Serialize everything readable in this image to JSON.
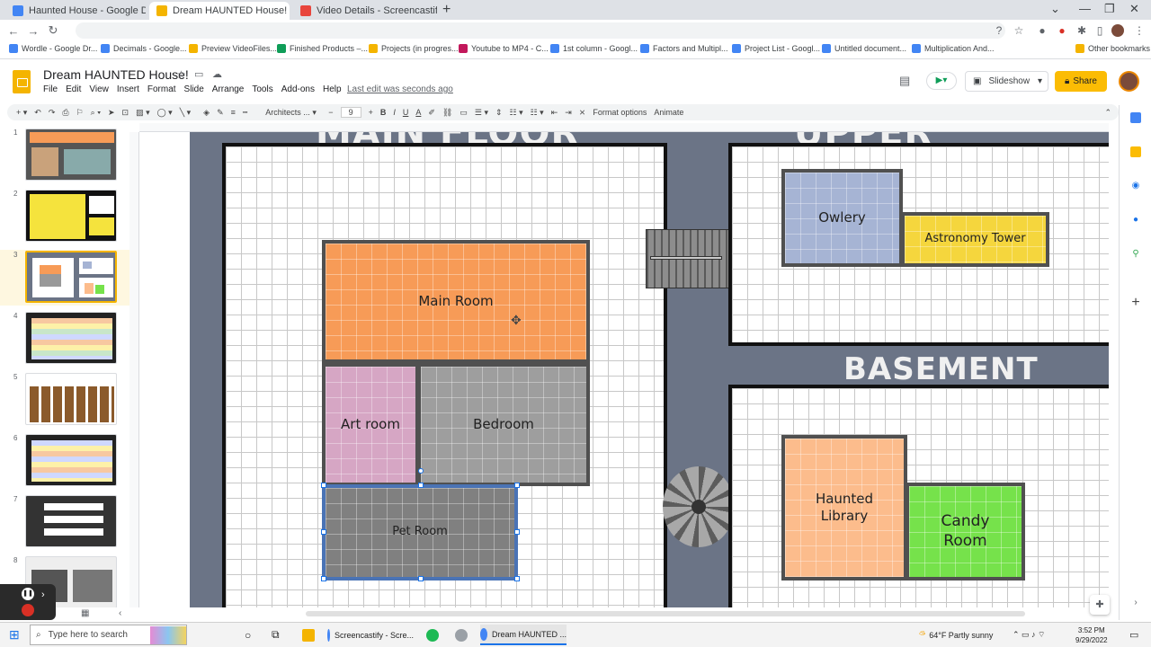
{
  "browser": {
    "tabs": [
      {
        "label": "Haunted House - Google Drive",
        "color": "#4285f4",
        "active": false
      },
      {
        "label": "Dream HAUNTED House! - Goog",
        "color": "#f4b400",
        "active": true
      },
      {
        "label": "Video Details - Screencastify",
        "color": "#e8453c",
        "active": false
      }
    ],
    "bookmarks": [
      {
        "label": "Wordle - Google Dr...",
        "color": "#4285f4"
      },
      {
        "label": "Decimals - Google...",
        "color": "#4285f4"
      },
      {
        "label": "Preview VideoFiles...",
        "color": "#f4b400"
      },
      {
        "label": "Finished Products –...",
        "color": "#0f9d58"
      },
      {
        "label": "Projects (in progres...",
        "color": "#f4b400"
      },
      {
        "label": "Youtube to MP4 - C...",
        "color": "#c2185b"
      },
      {
        "label": "1st column - Googl...",
        "color": "#4285f4"
      },
      {
        "label": "Factors and Multipl...",
        "color": "#4285f4"
      },
      {
        "label": "Project List - Googl...",
        "color": "#4285f4"
      },
      {
        "label": "Untitled document...",
        "color": "#4285f4"
      },
      {
        "label": "Multiplication And...",
        "color": "#4285f4"
      },
      {
        "label": "Other bookmarks",
        "color": "#f4b400"
      }
    ]
  },
  "docs": {
    "title": "Dream HAUNTED House!",
    "menu": [
      "File",
      "Edit",
      "View",
      "Insert",
      "Format",
      "Slide",
      "Arrange",
      "Tools",
      "Add-ons",
      "Help"
    ],
    "last_edit": "Last edit was seconds ago",
    "slideshow_label": "Slideshow",
    "share_label": "Share"
  },
  "toolbar": {
    "font": "Architects ...",
    "font_size": "9",
    "format_options": "Format options",
    "animate": "Animate"
  },
  "filmstrip": {
    "numbers": [
      "1",
      "2",
      "3",
      "4",
      "5",
      "6",
      "7",
      "8"
    ],
    "selected": "3"
  },
  "slide": {
    "sections": {
      "main_floor": "MAIN FLOOR",
      "upper_landing": "UPPER LANDING",
      "basement": "BASEMENT"
    },
    "rooms": {
      "main_room": "Main Room",
      "art_room": "Art room",
      "bedroom": "Bedroom",
      "pet_room": "Pet Room",
      "owlery": "Owlery",
      "astronomy_tower": "Astronomy Tower",
      "haunted_library": "Haunted\nLibrary",
      "candy_room": "Candy\nRoom"
    },
    "room_colors": {
      "main_room": "#f79b57",
      "art_room": "#d6a6c4",
      "bedroom": "#9e9e9e",
      "pet_room": "#808080",
      "owlery": "#a6b4d4",
      "astronomy_tower": "#f5d63d",
      "haunted_library": "#fcbc8c",
      "candy_room": "#76e24b"
    }
  },
  "taskbar": {
    "search_placeholder": "Type here to search",
    "items": [
      "Screencastify - Scre...",
      "Dream HAUNTED ..."
    ],
    "weather": "64°F  Partly sunny",
    "time": "3:52 PM",
    "date": "9/29/2022"
  }
}
